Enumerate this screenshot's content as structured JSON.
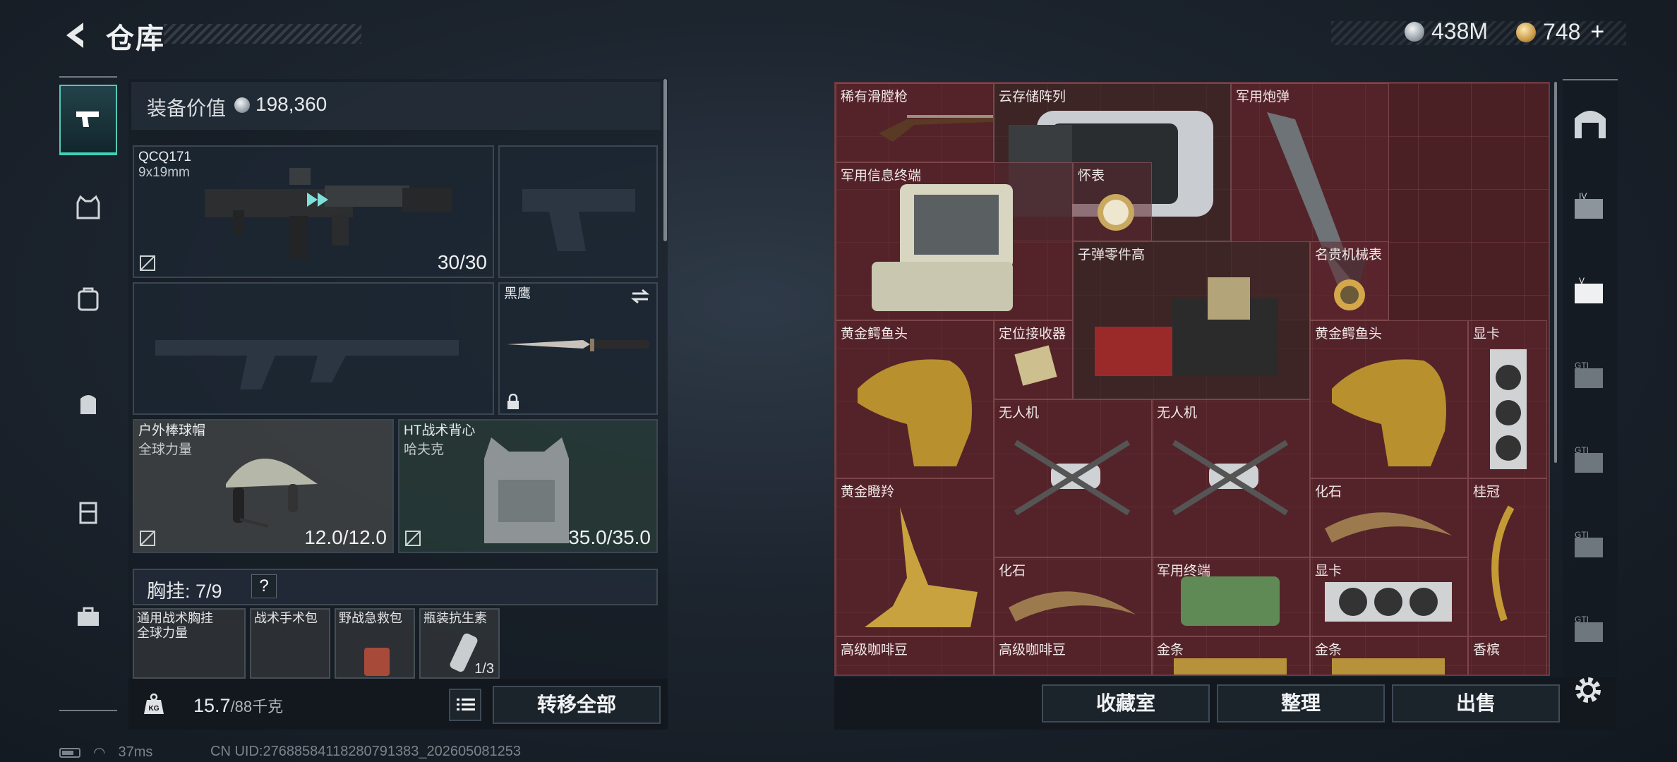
{
  "header": {
    "title": "仓库",
    "currency_silver": "438M",
    "currency_gold": "748",
    "plus": "+"
  },
  "equipment": {
    "value_label": "装备价值",
    "value": "198,360",
    "primary_weapon": {
      "name": "QCQ171",
      "ammo": "9x19mm",
      "count": "30/30"
    },
    "melee": {
      "name": "黑鹰"
    },
    "helmet": {
      "name": "户外棒球帽",
      "sub": "全球力量",
      "durability": "12.0/12.0"
    },
    "armor": {
      "name": "HT战术背心",
      "sub": "哈夫克",
      "durability": "35.0/35.0"
    },
    "chest_rig_label": "胸挂: 7/9",
    "help": "?",
    "chest_items": [
      {
        "name": "通用战术胸挂",
        "sub": "全球力量"
      },
      {
        "name": "战术手术包",
        "sub": ""
      },
      {
        "name": "野战急救包",
        "sub": ""
      },
      {
        "name": "瓶装抗生素",
        "sub": "",
        "count": "1/3"
      }
    ],
    "weight": "15.7",
    "weight_max": "/88千克",
    "transfer_all": "转移全部"
  },
  "storage_items": [
    {
      "name": "稀有滑膛枪"
    },
    {
      "name": "云存储阵列"
    },
    {
      "name": "军用炮弹"
    },
    {
      "name": "军用信息终端"
    },
    {
      "name": "怀表"
    },
    {
      "name": "子弹零件高"
    },
    {
      "name": "名贵机械表"
    },
    {
      "name": "黄金鳄鱼头"
    },
    {
      "name": "定位接收器"
    },
    {
      "name": "黄金鳄鱼头"
    },
    {
      "name": "显卡"
    },
    {
      "name": "无人机"
    },
    {
      "name": "无人机"
    },
    {
      "name": "黄金瞪羚"
    },
    {
      "name": "化石"
    },
    {
      "name": "桂冠"
    },
    {
      "name": "化石"
    },
    {
      "name": "军用终端"
    },
    {
      "name": "显卡"
    },
    {
      "name": "高级咖啡豆"
    },
    {
      "name": "高级咖啡豆"
    },
    {
      "name": "金条"
    },
    {
      "name": "金条"
    },
    {
      "name": "香槟"
    }
  ],
  "actions": {
    "collection": "收藏室",
    "sort": "整理",
    "sell": "出售"
  },
  "status": {
    "ping": "37ms",
    "uid": "CN UID:27688584118280791383_202605081253"
  },
  "colors": {
    "accent": "#3fd0b4",
    "storage_bg": "#4a2025"
  }
}
